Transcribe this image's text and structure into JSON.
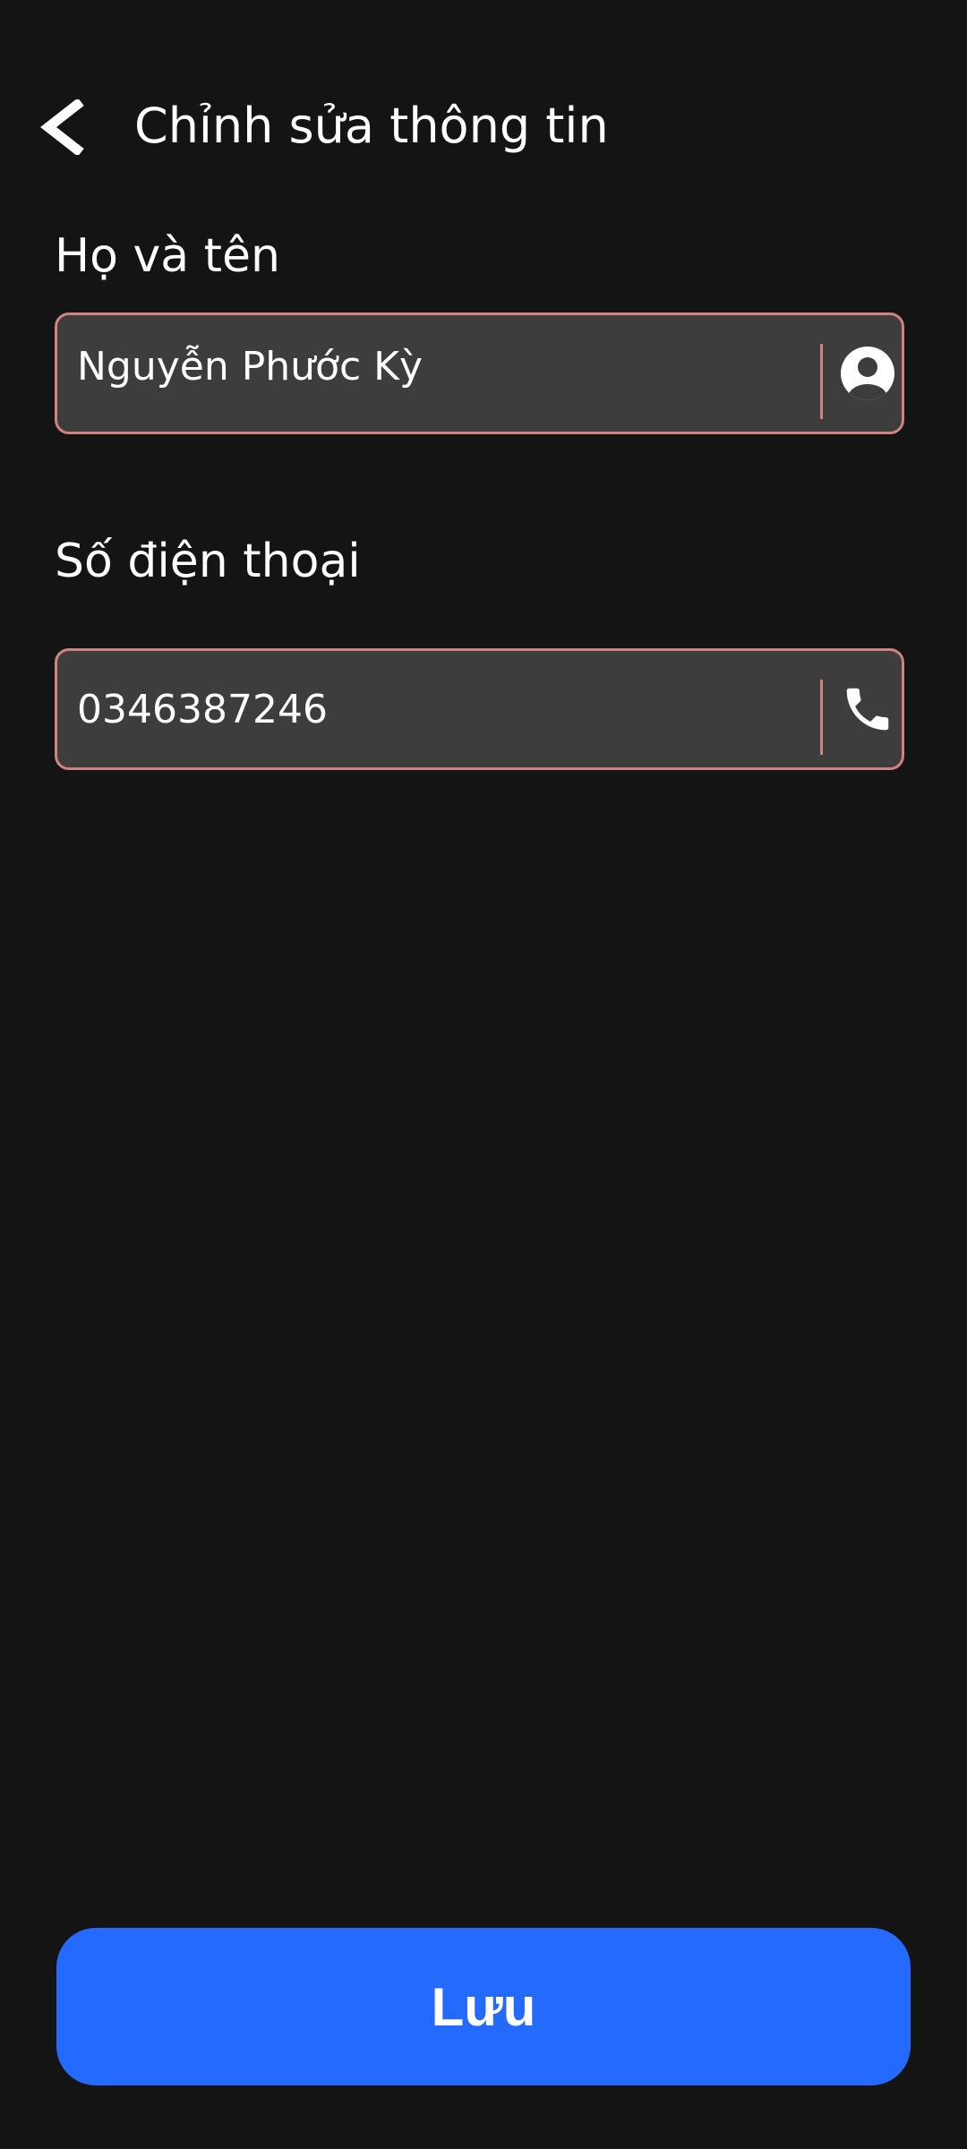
{
  "header": {
    "back_icon": "chevron-left-icon",
    "title": "Chỉnh sửa thông tin"
  },
  "form": {
    "name": {
      "label": "Họ và tên",
      "value": "Nguyễn Phước Kỳ",
      "icon": "user-circle-icon"
    },
    "phone": {
      "label": "Số điện thoại",
      "value": "0346387246",
      "icon": "phone-icon"
    }
  },
  "actions": {
    "save_label": "Lưu"
  },
  "colors": {
    "background": "#141414",
    "field_background": "#3d3d3d",
    "field_border": "#d08482",
    "primary": "#246bfd",
    "text": "#ffffff"
  }
}
